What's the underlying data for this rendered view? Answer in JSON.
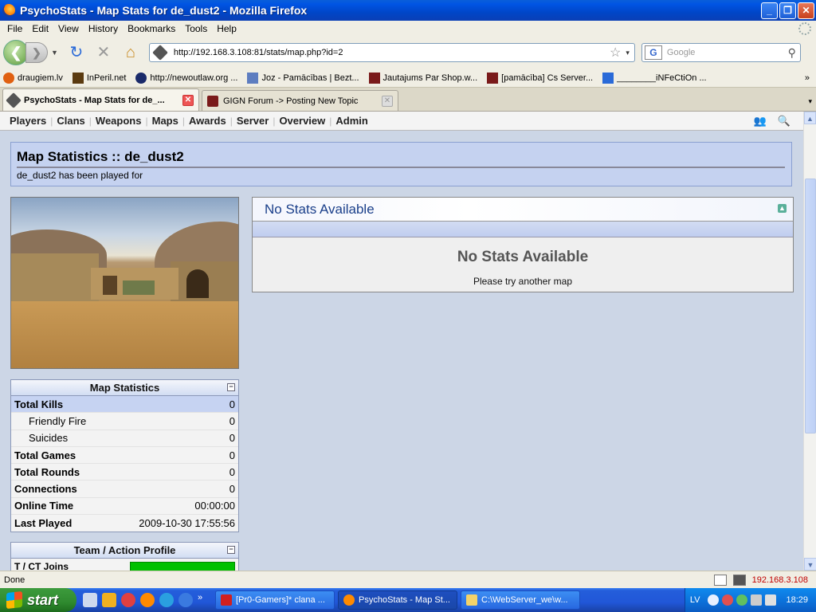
{
  "window": {
    "title": "PsychoStats - Map Stats for de_dust2 - Mozilla Firefox",
    "min": "_",
    "max": "❐",
    "close": "✕"
  },
  "menu": [
    "File",
    "Edit",
    "View",
    "History",
    "Bookmarks",
    "Tools",
    "Help"
  ],
  "nav": {
    "url": "http://192.168.3.108:81/stats/map.php?id=2",
    "search_placeholder": "Google",
    "search_engine": "G",
    "back": "❮",
    "forward": "❯",
    "history_drop": "▼",
    "reload": "↻",
    "stop": "✕",
    "home": "⌂",
    "star": "☆",
    "url_drop": "▾",
    "search_mag": "⚲"
  },
  "bookmarks": [
    {
      "label": "draugiem.lv",
      "color": "#e06010"
    },
    {
      "label": "InPeril.net",
      "color": "#5a3a10"
    },
    {
      "label": "http://newoutlaw.org ...",
      "color": "#1a2a6a"
    },
    {
      "label": "Joz - Pamācības | Bezt...",
      "color": "#5d7dc0"
    },
    {
      "label": "Jautajums Par Shop.w...",
      "color": "#7a1a1a"
    },
    {
      "label": "[pamācība] Cs Server...",
      "color": "#7a1a1a"
    },
    {
      "label": "________iNFeCtiOn ...",
      "color": "#2a6ad8"
    }
  ],
  "bookmarks_more": "»",
  "tabs": [
    {
      "label": "PsychoStats - Map Stats for de_...",
      "active": true
    },
    {
      "label": "GIGN Forum -> Posting New Topic",
      "active": false
    }
  ],
  "tab_close": "✕",
  "tab_menu": "▾",
  "site_nav": [
    "Players",
    "Clans",
    "Weapons",
    "Maps",
    "Awards",
    "Server",
    "Overview",
    "Admin"
  ],
  "site_nav_sep": "|",
  "site_nav_icons": {
    "users": "👥",
    "search": "🔍"
  },
  "page": {
    "title": "Map Statistics :: de_dust2",
    "subtitle": "de_dust2 has been played for"
  },
  "map_stats": {
    "heading": "Map Statistics",
    "collapse": "−",
    "rows": [
      {
        "label": "Total Kills",
        "value": "0"
      },
      {
        "label": "Friendly Fire",
        "value": "0"
      },
      {
        "label": "Suicides",
        "value": "0"
      },
      {
        "label": "Total Games",
        "value": "0"
      },
      {
        "label": "Total Rounds",
        "value": "0"
      },
      {
        "label": "Connections",
        "value": "0"
      },
      {
        "label": "Online Time",
        "value": "00:00:00"
      },
      {
        "label": "Last Played",
        "value": "2009-10-30 17:55:56"
      }
    ]
  },
  "team_profile": {
    "heading": "Team / Action Profile",
    "collapse": "−",
    "row_label": "T / CT Joins"
  },
  "no_stats": {
    "header": "No Stats Available",
    "message": "No Stats Available",
    "hint": "Please try another map",
    "up": "▲"
  },
  "scroll": {
    "up": "▲",
    "down": "▼"
  },
  "status": {
    "text": "Done",
    "ip": "192.168.3.108"
  },
  "taskbar": {
    "start": "start",
    "quick_more": "»",
    "tasks": [
      {
        "label": "[Pr0-Gamers]* clana ...",
        "color": "#d02020"
      },
      {
        "label": "PsychoStats - Map St...",
        "color": "#ff8a00"
      },
      {
        "label": "C:\\WebServer_we\\w...",
        "color": "#f3d36a"
      }
    ],
    "lang": "LV",
    "clock": "18:29"
  }
}
